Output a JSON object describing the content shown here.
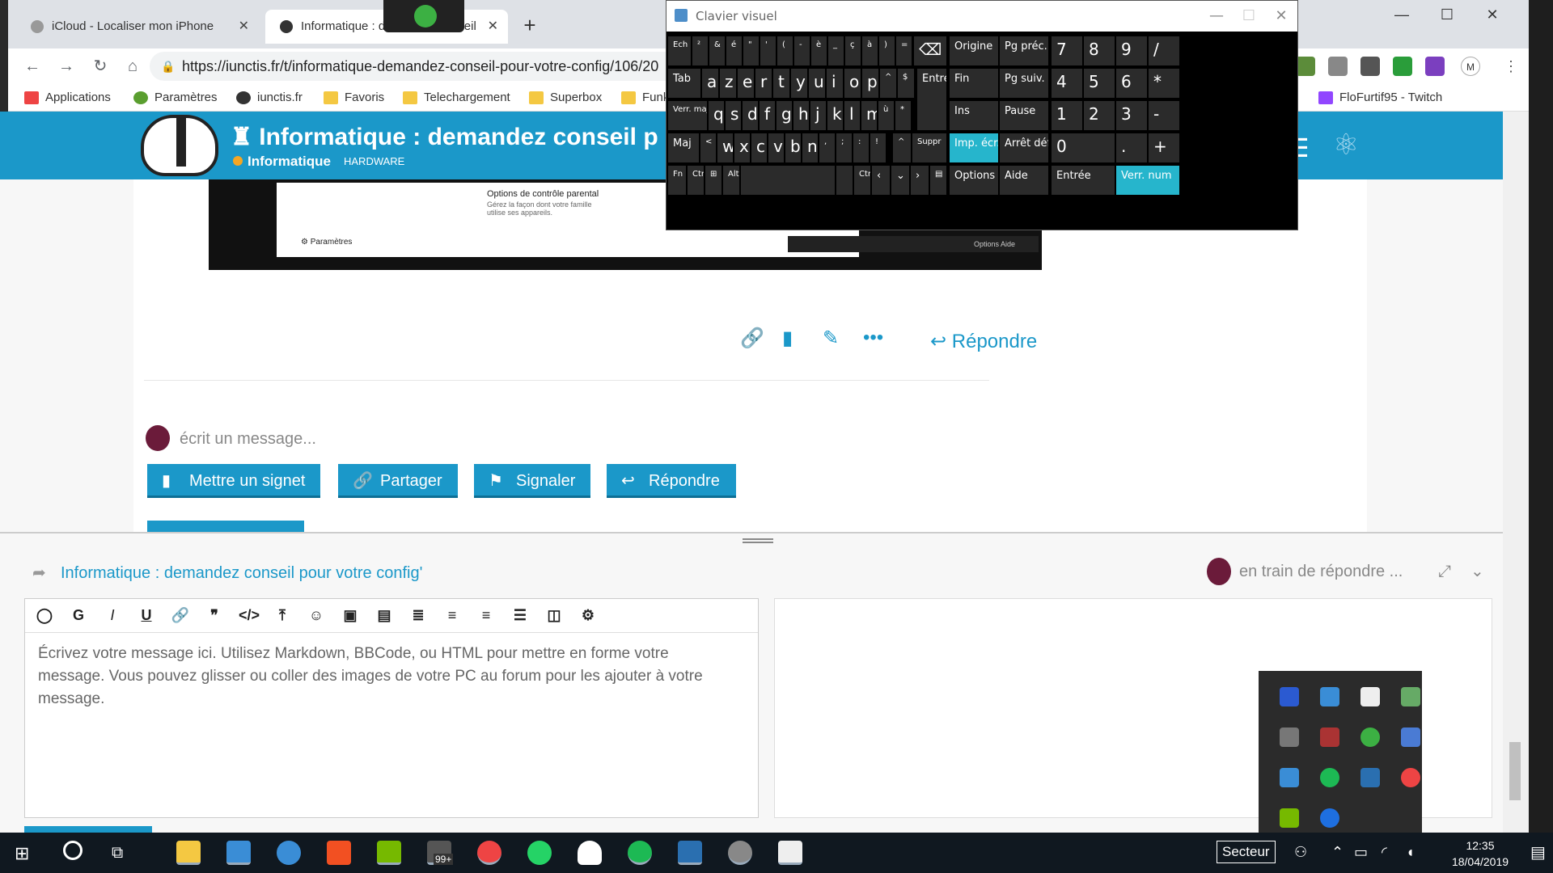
{
  "browser": {
    "tabs": [
      {
        "label": "iCloud - Localiser mon iPhone"
      },
      {
        "label": "Informatique : demandez conseil"
      }
    ],
    "address": "https://iunctis.fr/t/informatique-demandez-conseil-pour-votre-config/106/20",
    "bookmarks": [
      {
        "label": "Applications"
      },
      {
        "label": "Paramètres"
      },
      {
        "label": "iunctis.fr"
      },
      {
        "label": "Favoris"
      },
      {
        "label": "Telechargement"
      },
      {
        "label": "Superbox"
      },
      {
        "label": "Funko"
      },
      {
        "label": "FloFurtif95 - Twitch"
      }
    ],
    "profile_initial": "M"
  },
  "site": {
    "title": "Informatique : demandez conseil p",
    "category": "Informatique",
    "tag": "HARDWARE"
  },
  "post": {
    "embedded": {
      "title": "Options de contrôle parental",
      "subtitle": "Gérez la façon dont votre famille utilise ses appareils.",
      "settings": "Paramètres",
      "mini_keys": "Options   Aide"
    },
    "reply_label": "Répondre",
    "writing": "écrit un message...",
    "buttons": [
      {
        "label": "Mettre un signet"
      },
      {
        "label": "Partager"
      },
      {
        "label": "Signaler"
      },
      {
        "label": "Répondre"
      }
    ]
  },
  "composer": {
    "title": "Informatique : demandez conseil pour votre config'",
    "replying": "en train de répondre ...",
    "placeholder": "Écrivez votre message ici. Utilisez Markdown, BBCode, ou HTML pour mettre en forme votre message. Vous pouvez glisser ou coller des images de votre PC au forum pour les ajouter à votre message.",
    "toolbar_letters": {
      "bold": "G",
      "italic": "I",
      "underline": "U"
    }
  },
  "osk": {
    "title": "Clavier visuel",
    "keys": {
      "ech": "Ech",
      "tab": "Tab",
      "vermaj": "Verr. maj",
      "maj": "Maj",
      "fn": "Fn",
      "ctrl": "Ctrl",
      "alt": "Alt",
      "entree": "Entrée",
      "suppr": "Suppr",
      "row1": [
        "²",
        "&",
        "é",
        "\"",
        "'",
        "(",
        "-",
        "è",
        "_",
        "ç",
        "à",
        ")",
        "="
      ],
      "row2": [
        "a",
        "z",
        "e",
        "r",
        "t",
        "y",
        "u",
        "i",
        "o",
        "p",
        "^",
        "$"
      ],
      "row3": [
        "q",
        "s",
        "d",
        "f",
        "g",
        "h",
        "j",
        "k",
        "l",
        "m",
        "ù",
        "*"
      ],
      "row4": [
        "<",
        "w",
        "x",
        "c",
        "v",
        "b",
        "n",
        ",",
        ";",
        ":",
        "!"
      ],
      "nav": [
        "Origine",
        "Pg préc.",
        "Fin",
        "Pg suiv.",
        "Ins",
        "Pause",
        "Imp. écr.",
        "Arrêt défil",
        "Options",
        "Aide"
      ],
      "num": [
        "7",
        "8",
        "9",
        "/",
        "4",
        "5",
        "6",
        "*",
        "1",
        "2",
        "3",
        "-",
        "0",
        ".",
        "+"
      ],
      "num_enter": "Entrée",
      "numlock": "Verr. num"
    }
  },
  "taskbar": {
    "language": "Secteur",
    "time": "12:35",
    "date": "18/04/2019",
    "badge": "99+"
  },
  "colors": {
    "accent": "#1b98c9",
    "osk_highlight": "#26b5cc",
    "taskbar": "#101820"
  }
}
